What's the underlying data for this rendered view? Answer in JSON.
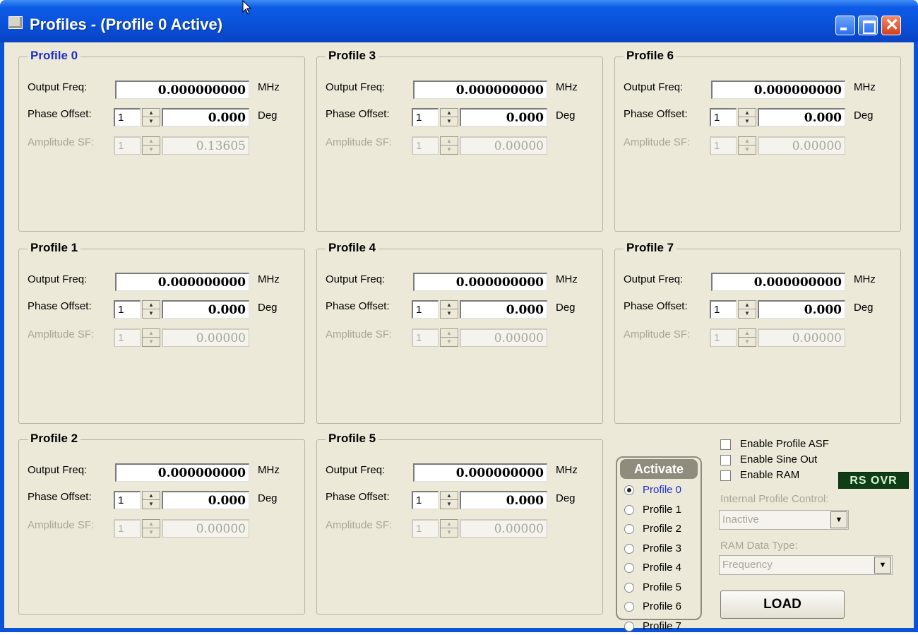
{
  "window": {
    "title": "Profiles - (Profile 0 Active)",
    "title_bar_color": "#0a52d6",
    "close_glyph": "✕"
  },
  "profiles": [
    {
      "name": "Profile 0",
      "output_freq": "0.000000000",
      "phase_index": "1",
      "phase_offset": "0.000",
      "amp_index": "1",
      "amp_sf": "0.13605",
      "active": true
    },
    {
      "name": "Profile 1",
      "output_freq": "0.000000000",
      "phase_index": "1",
      "phase_offset": "0.000",
      "amp_index": "1",
      "amp_sf": "0.00000",
      "active": false
    },
    {
      "name": "Profile 2",
      "output_freq": "0.000000000",
      "phase_index": "1",
      "phase_offset": "0.000",
      "amp_index": "1",
      "amp_sf": "0.00000",
      "active": false
    },
    {
      "name": "Profile 3",
      "output_freq": "0.000000000",
      "phase_index": "1",
      "phase_offset": "0.000",
      "amp_index": "1",
      "amp_sf": "0.00000",
      "active": false
    },
    {
      "name": "Profile 4",
      "output_freq": "0.000000000",
      "phase_index": "1",
      "phase_offset": "0.000",
      "amp_index": "1",
      "amp_sf": "0.00000",
      "active": false
    },
    {
      "name": "Profile 5",
      "output_freq": "0.000000000",
      "phase_index": "1",
      "phase_offset": "0.000",
      "amp_index": "1",
      "amp_sf": "0.00000",
      "active": false
    },
    {
      "name": "Profile 6",
      "output_freq": "0.000000000",
      "phase_index": "1",
      "phase_offset": "0.000",
      "amp_index": "1",
      "amp_sf": "0.00000",
      "active": false
    },
    {
      "name": "Profile 7",
      "output_freq": "0.000000000",
      "phase_index": "1",
      "phase_offset": "0.000",
      "amp_index": "1",
      "amp_sf": "0.00000",
      "active": false
    }
  ],
  "labels": {
    "output_freq": "Output Freq:",
    "phase_offset": "Phase Offset:",
    "amplitude_sf": "Amplitude SF:",
    "mhz": "MHz",
    "deg": "Deg"
  },
  "activate": {
    "title": "Activate",
    "options": [
      "Profile 0",
      "Profile 1",
      "Profile 2",
      "Profile 3",
      "Profile 4",
      "Profile 5",
      "Profile 6",
      "Profile 7"
    ],
    "selected": "Profile 0"
  },
  "options": {
    "enable_profile_asf": "Enable Profile ASF",
    "enable_sine_out": "Enable Sine Out",
    "enable_ram": "Enable RAM",
    "rs_ovr": "RS OVR",
    "internal_profile_control_label": "Internal Profile Control:",
    "internal_profile_control_value": "Inactive",
    "ram_data_type_label": "RAM Data Type:",
    "ram_data_type_value": "Frequency",
    "load_button": "LOAD"
  }
}
